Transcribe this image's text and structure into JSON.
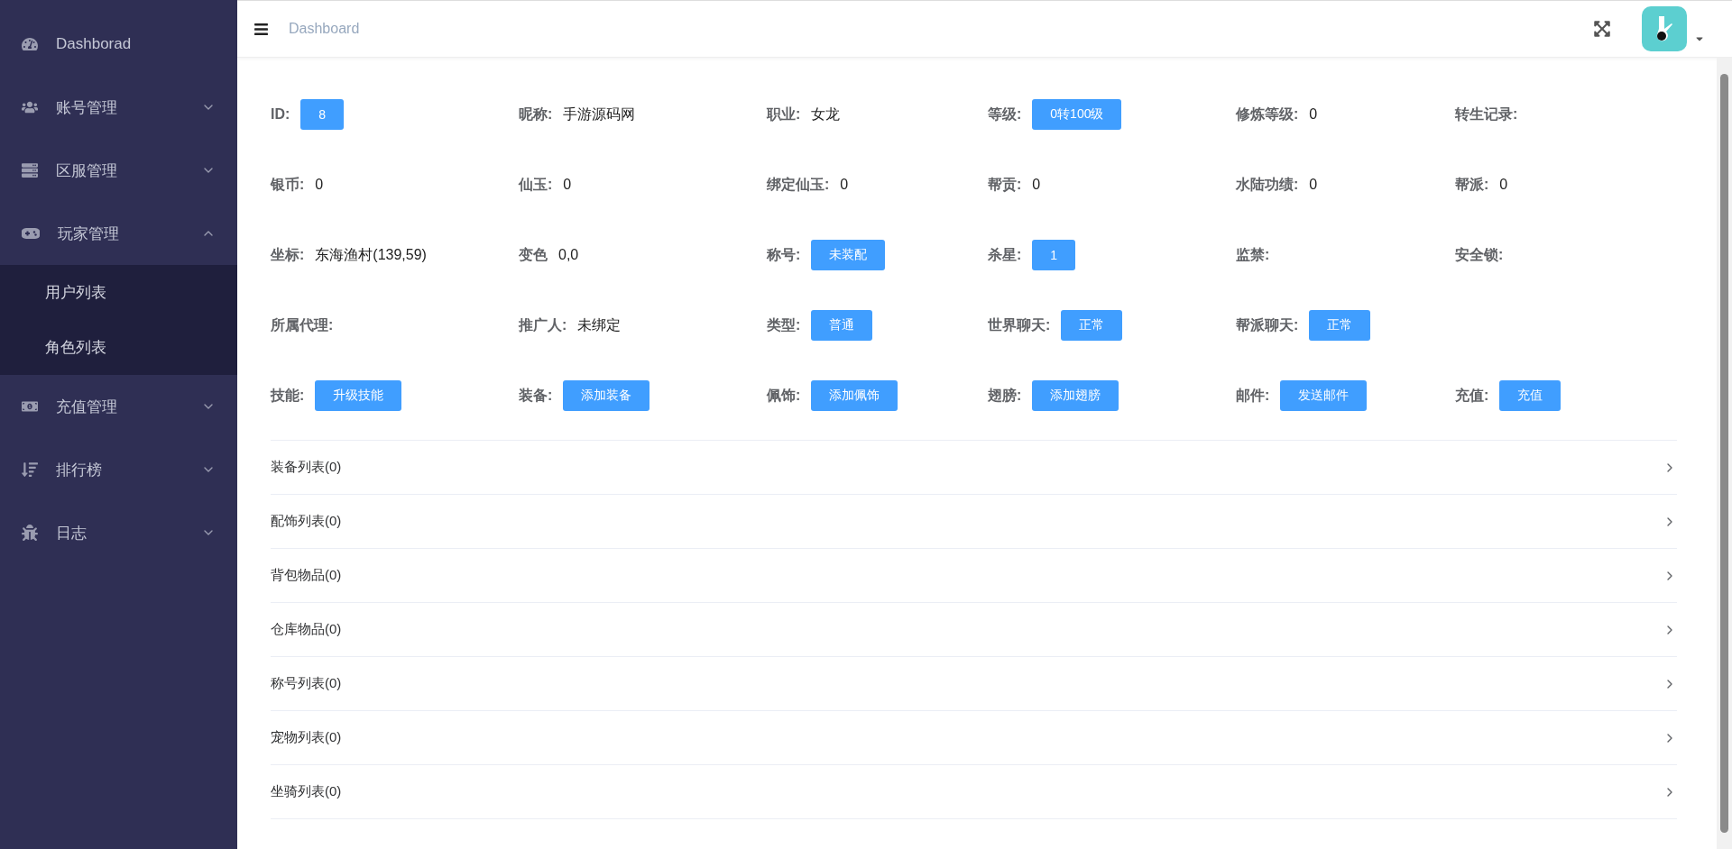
{
  "sidebar": {
    "items": [
      {
        "label": "Dashborad"
      },
      {
        "label": "账号管理",
        "expanded": false
      },
      {
        "label": "区服管理",
        "expanded": false
      },
      {
        "label": "玩家管理",
        "expanded": true,
        "children": [
          {
            "label": "用户列表"
          },
          {
            "label": "角色列表"
          }
        ]
      },
      {
        "label": "充值管理",
        "expanded": false
      },
      {
        "label": "排行榜",
        "expanded": false
      },
      {
        "label": "日志",
        "expanded": false
      }
    ]
  },
  "header": {
    "breadcrumb": "Dashboard"
  },
  "fields": [
    {
      "label": "ID:",
      "kind": "button",
      "value": "8"
    },
    {
      "label": "昵称:",
      "kind": "text",
      "value": "手游源码网"
    },
    {
      "label": "职业:",
      "kind": "text",
      "value": "女龙"
    },
    {
      "label": "等级:",
      "kind": "button",
      "value": "0转100级"
    },
    {
      "label": "修炼等级:",
      "kind": "text",
      "value": "0"
    },
    {
      "label": "转生记录:",
      "kind": "empty"
    },
    {
      "label": "银币:",
      "kind": "text",
      "value": "0"
    },
    {
      "label": "仙玉:",
      "kind": "text",
      "value": "0"
    },
    {
      "label": "绑定仙玉:",
      "kind": "text",
      "value": "0"
    },
    {
      "label": "帮贡:",
      "kind": "text",
      "value": "0"
    },
    {
      "label": "水陆功绩:",
      "kind": "text",
      "value": "0"
    },
    {
      "label": "帮派:",
      "kind": "text",
      "value": "0"
    },
    {
      "label": "坐标:",
      "kind": "text",
      "value": "东海渔村(139,59)"
    },
    {
      "label": "变色",
      "kind": "text",
      "value": "0,0"
    },
    {
      "label": "称号:",
      "kind": "button",
      "value": "未装配"
    },
    {
      "label": "杀星:",
      "kind": "button",
      "value": "1"
    },
    {
      "label": "监禁:",
      "kind": "empty"
    },
    {
      "label": "安全锁:",
      "kind": "empty"
    },
    {
      "label": "所属代理:",
      "kind": "empty"
    },
    {
      "label": "推广人:",
      "kind": "text",
      "value": "未绑定"
    },
    {
      "label": "类型:",
      "kind": "button",
      "value": "普通"
    },
    {
      "label": "世界聊天:",
      "kind": "button",
      "value": "正常"
    },
    {
      "label": "帮派聊天:",
      "kind": "button",
      "value": "正常"
    },
    {
      "kind": "blank"
    },
    {
      "label": "技能:",
      "kind": "button",
      "value": "升级技能"
    },
    {
      "label": "装备:",
      "kind": "button",
      "value": "添加装备"
    },
    {
      "label": "佩饰:",
      "kind": "button",
      "value": "添加佩饰"
    },
    {
      "label": "翅膀:",
      "kind": "button",
      "value": "添加翅膀"
    },
    {
      "label": "邮件:",
      "kind": "button",
      "value": "发送邮件"
    },
    {
      "label": "充值:",
      "kind": "button",
      "value": "充值"
    }
  ],
  "collapse": [
    {
      "title": "装备列表(0)",
      "expanded": false
    },
    {
      "title": "配饰列表(0)",
      "expanded": false
    },
    {
      "title": "背包物品(0)",
      "expanded": false
    },
    {
      "title": "仓库物品(0)",
      "expanded": false
    },
    {
      "title": "称号列表(0)",
      "expanded": false
    },
    {
      "title": "宠物列表(0)",
      "expanded": false
    },
    {
      "title": "坐骑列表(0)",
      "expanded": false
    }
  ]
}
